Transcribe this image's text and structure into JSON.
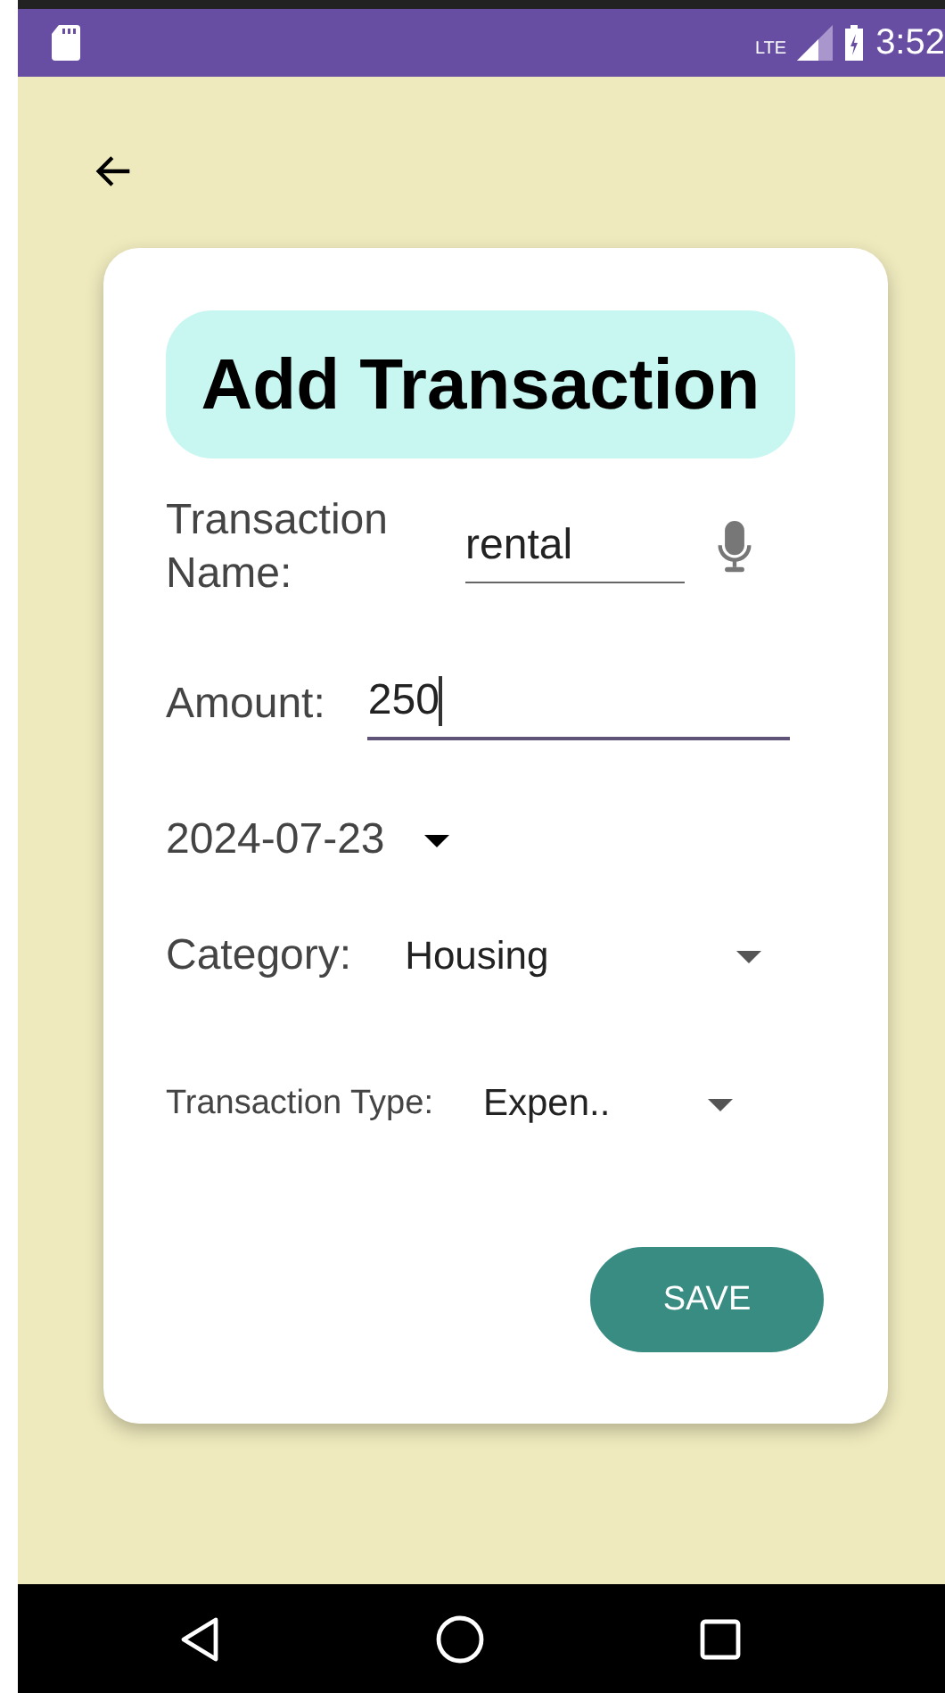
{
  "status_bar": {
    "time": "3:52",
    "network": "LTE"
  },
  "title": "Add Transaction",
  "name_field": {
    "label": "Transaction Name:",
    "value": "rental"
  },
  "amount_field": {
    "label": "Amount:",
    "value": "250",
    "focused": true
  },
  "date": {
    "value": "2024-07-23"
  },
  "category": {
    "label": "Category:",
    "value": "Housing"
  },
  "type": {
    "label": "Transaction Type:",
    "value": "Expen.."
  },
  "save_button": "SAVE"
}
